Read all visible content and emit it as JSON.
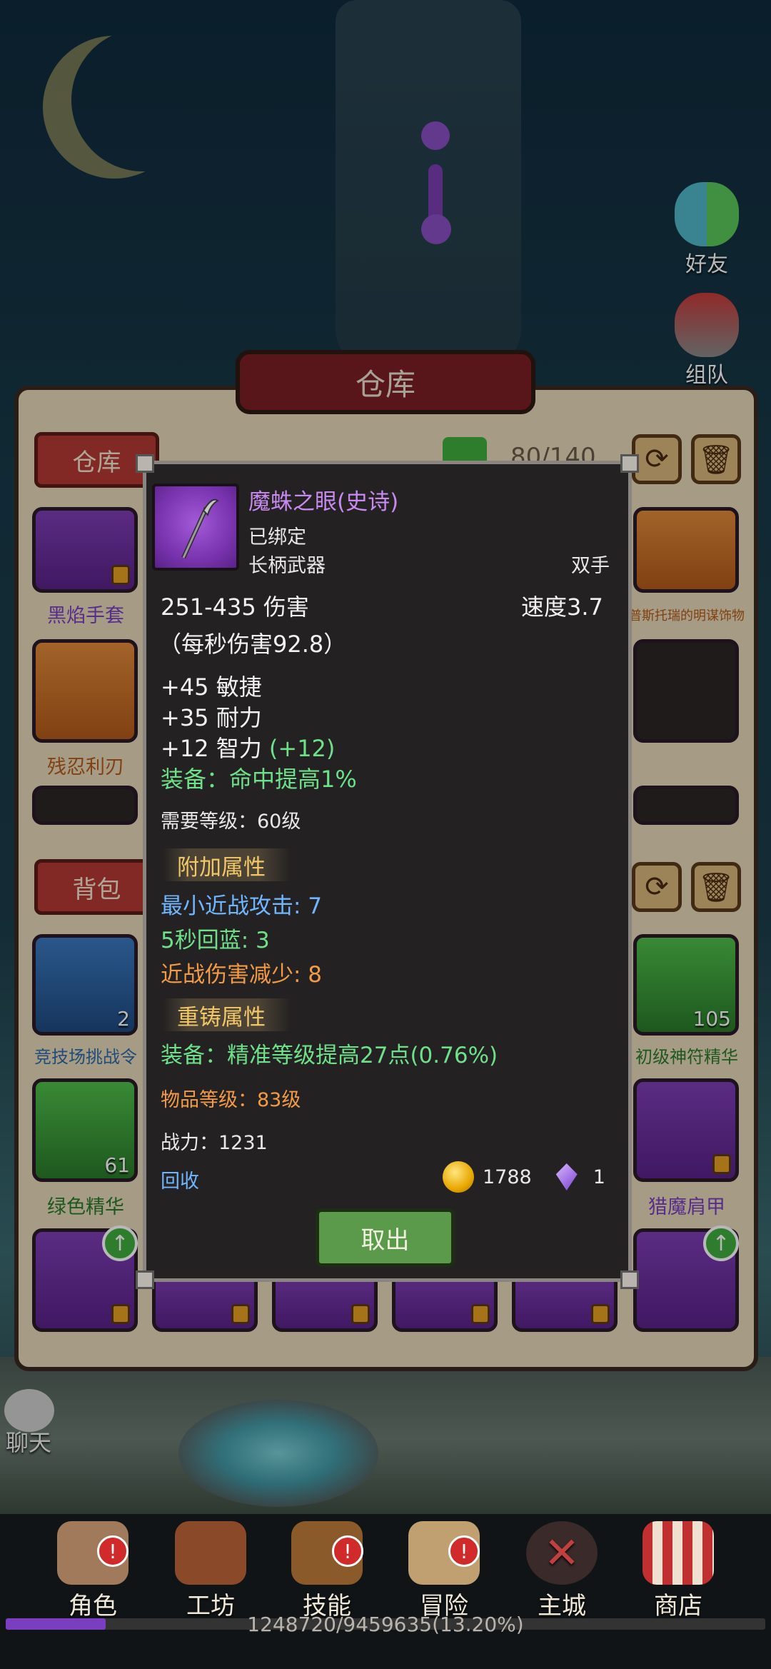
{
  "sidebar": {
    "friends_label": "好友",
    "team_label": "组队",
    "chat_label": "聊天"
  },
  "warehouse": {
    "title": "仓库",
    "storage_tab": "仓库",
    "capacity": "80/140",
    "bag_tab": "背包",
    "storage_items": [
      {
        "label": "黑焰手套",
        "color": "purple",
        "locked": true
      },
      {
        "label": "残忍利刃",
        "color": "orange",
        "locked": false
      },
      {
        "label": "普斯托瑞的明谋饰物",
        "color": "orange",
        "locked": false
      }
    ],
    "bag_items": [
      {
        "label": "竞技场挑战令",
        "count": "2",
        "color": "blue"
      },
      {
        "label": "初级神符精华",
        "count": "105",
        "color": "green"
      },
      {
        "label": "绿色精华",
        "count": "61",
        "color": "green"
      },
      {
        "label": "猎魔肩甲",
        "count": "",
        "color": "purple"
      }
    ]
  },
  "tooltip": {
    "name": "魔蛛之眼(史诗)",
    "bound": "已绑定",
    "type": "长柄武器",
    "hand": "双手",
    "damage": "251-435 伤害",
    "speed": "速度3.7",
    "dps": "（每秒伤害92.8）",
    "stats": [
      "+45 敏捷",
      "+35 耐力",
      "+12 智力"
    ],
    "int_bonus": "(+12)",
    "equip_effect": "装备：命中提高1%",
    "required_level": "需要等级：60级",
    "extra_header": "附加属性",
    "extra_attrs": [
      {
        "text": "最小近战攻击: 7",
        "color": "#6fb6ff"
      },
      {
        "text": "5秒回蓝: 3",
        "color": "#6fe08a"
      },
      {
        "text": "近战伤害减少: 8",
        "color": "#f29a45"
      }
    ],
    "reforge_header": "重铸属性",
    "reforge_attr": "装备：精准等级提高27点(0.76%)",
    "item_level": "物品等级：83级",
    "power": "战力：1231",
    "recycle": "回收",
    "gold": "1788",
    "gems": "1",
    "take_out": "取出",
    "name_color": "#c98af0"
  },
  "nav": {
    "items": [
      {
        "label": "角色",
        "badge": "!"
      },
      {
        "label": "工坊",
        "badge": ""
      },
      {
        "label": "技能",
        "badge": "!"
      },
      {
        "label": "冒险",
        "badge": "!"
      },
      {
        "label": "主城",
        "badge": ""
      },
      {
        "label": "商店",
        "badge": ""
      }
    ],
    "xp_text": "1248720/9459635(13.20%)",
    "xp_fraction": 0.132
  }
}
